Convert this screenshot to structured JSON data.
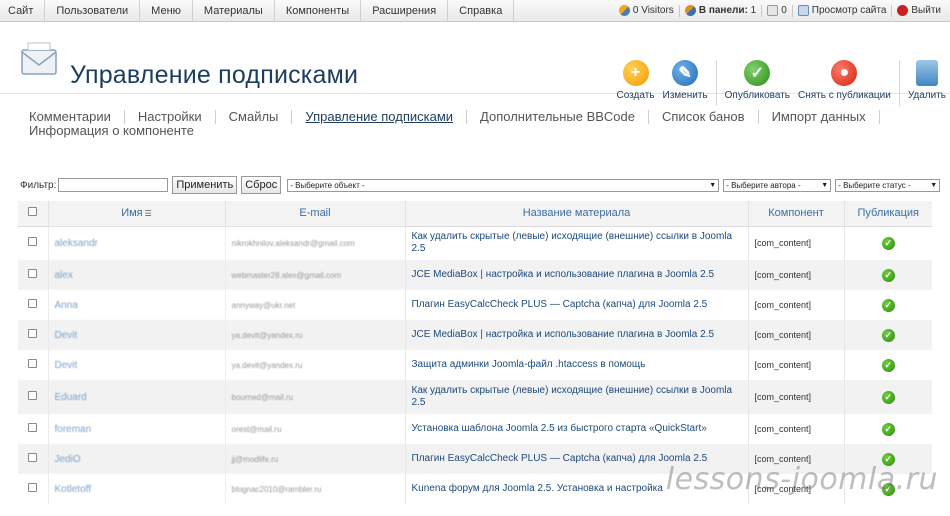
{
  "topmenu": {
    "items": [
      "Сайт",
      "Пользователи",
      "Меню",
      "Материалы",
      "Компоненты",
      "Расширения",
      "Справка"
    ]
  },
  "status": {
    "visitors": "0 Visitors",
    "panel_label": "В панели:",
    "panel_count": "1",
    "messages": "0",
    "view_site": "Просмотр сайта",
    "logout": "Выйти"
  },
  "header": {
    "title": "Управление подписками"
  },
  "toolbar": {
    "create": "Создать",
    "edit": "Изменить",
    "publish": "Опубликовать",
    "unpublish": "Снять с публикации",
    "delete": "Удалить"
  },
  "submenu": {
    "row1": [
      "Комментарии",
      "Настройки",
      "Смайлы",
      "Управление подписками",
      "Дополнительные BBCode",
      "Список банов",
      "Импорт данных"
    ],
    "row2": "Информация о компоненте"
  },
  "filter": {
    "label": "Фильтр:",
    "value": "",
    "apply": "Применить",
    "reset": "Сброс",
    "object_select": "- Выберите объект -",
    "author_select": "- Выберите автора -",
    "status_select": "- Выберите статус -"
  },
  "table": {
    "headers": {
      "name": "Имя",
      "email": "E-mail",
      "title": "Название материала",
      "component": "Компонент",
      "published": "Публикация"
    },
    "rows": [
      {
        "name": "aleksandr",
        "email": "nikrokhnilov.aleksandr@gmail.com",
        "title": "Как удалить скрытые (левые) исходящие (внешние) ссылки в Joomla 2.5",
        "component": "[com_content]"
      },
      {
        "name": "alex",
        "email": "webmaster28.alex@gmail.com",
        "title": "JCE MediaBox | настройка и использование плагина в Joomla 2.5",
        "component": "[com_content]"
      },
      {
        "name": "Anna",
        "email": "annyway@ukr.net",
        "title": "Плагин EasyCalcCheck PLUS — Captcha (капча) для Joomla 2.5",
        "component": "[com_content]"
      },
      {
        "name": "Devit",
        "email": "ya.devit@yandex.ru",
        "title": "JCE MediaBox | настройка и использование плагина в Joomla 2.5",
        "component": "[com_content]"
      },
      {
        "name": "Devit",
        "email": "ya.devit@yandex.ru",
        "title": "Защита админки Joomla-файл .htaccess в помощь",
        "component": "[com_content]"
      },
      {
        "name": "Eduard",
        "email": "bourned@mail.ru",
        "title": "Как удалить скрытые (левые) исходящие (внешние) ссылки в Joomla 2.5",
        "component": "[com_content]"
      },
      {
        "name": "foreman",
        "email": "orest@mail.ru",
        "title": "Установка шаблона Joomla 2.5 из быстрого старта «QuickStart»",
        "component": "[com_content]"
      },
      {
        "name": "JediO",
        "email": "jj@modlife.ru",
        "title": "Плагин EasyCalcCheck PLUS — Captcha (капча) для Joomla 2.5",
        "component": "[com_content]"
      },
      {
        "name": "Kotletoff",
        "email": "blognac2010@rambler.ru",
        "title": "Kunena форум для Joomla 2.5. Установка и настройка",
        "component": "[com_content]"
      }
    ]
  },
  "watermark": "lessons-joomla.ru",
  "colors": {
    "title": "#1c3d5e",
    "link": "#1c4a7a",
    "header_link": "#3b6ea5",
    "publish_green": "#2c8a12"
  }
}
